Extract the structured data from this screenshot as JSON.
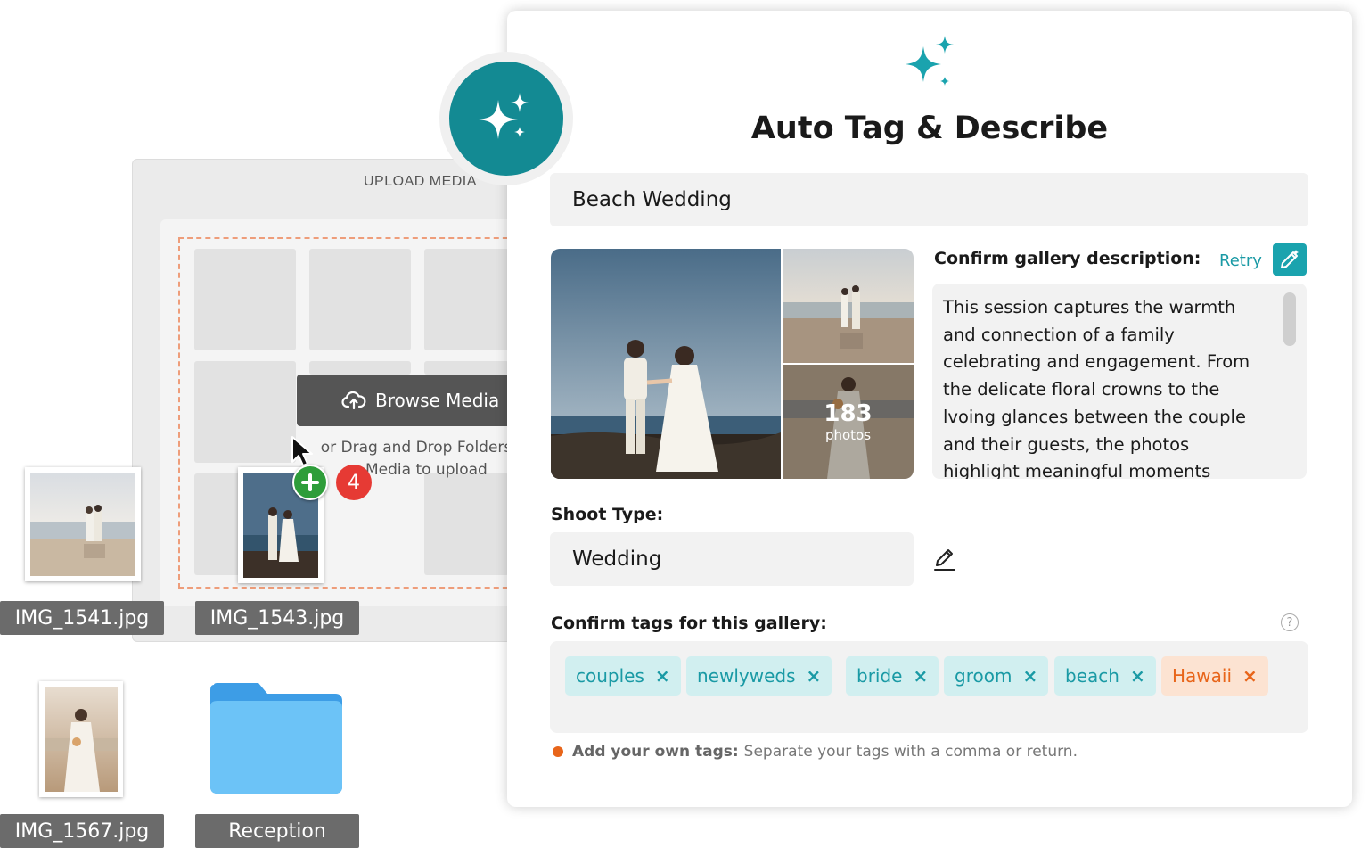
{
  "upload": {
    "title": "UPLOAD MEDIA",
    "browse_label": "Browse Media",
    "drag_text": "or Drag and Drop Folders or Media to upload"
  },
  "drag": {
    "count": "4"
  },
  "files": [
    {
      "name": "IMG_1541.jpg"
    },
    {
      "name": "IMG_1543.jpg"
    },
    {
      "name": "IMG_1567.jpg"
    },
    {
      "name": "Reception"
    }
  ],
  "modal": {
    "title": "Auto Tag & Describe",
    "gallery_name": "Beach Wedding",
    "photo_count": "183",
    "photo_count_label": "photos",
    "description_heading": "Confirm gallery description:",
    "retry_label": "Retry",
    "description": "This session captures the warmth and connection of a family celebrating and engagement. From the delicate floral crowns to the lvoing glances between the couple and their guests, the photos highlight meaningful moments shared with the bride, groom, and",
    "shoot_type_label": "Shoot Type:",
    "shoot_type_value": "Wedding",
    "tags_heading": "Confirm tags for this gallery:",
    "help_glyph": "?",
    "tags": [
      {
        "label": "couples"
      },
      {
        "label": "newlyweds"
      },
      {
        "label": "bride"
      },
      {
        "label": "groom"
      },
      {
        "label": "beach"
      },
      {
        "label": "Hawaii"
      }
    ],
    "tag_remove_glyph": "×",
    "hint_bold": "Add your own tags:",
    "hint_text": "Separate your tags with a comma or return."
  },
  "colors": {
    "accent_teal": "#138a93",
    "tag_teal_bg": "#d1eff0",
    "tag_orange_bg": "#fce3d2",
    "tag_orange_text": "#e8651a",
    "badge_green": "#2e9d3a",
    "badge_red": "#e63a34",
    "dropzone_border": "#ee9d7a"
  },
  "icons": [
    "sparkle-icon",
    "cloud-upload-icon",
    "cursor-arrow-icon",
    "plus-icon",
    "edit-pencil-icon",
    "pencil-icon",
    "help-icon",
    "folder-icon",
    "close-icon"
  ]
}
